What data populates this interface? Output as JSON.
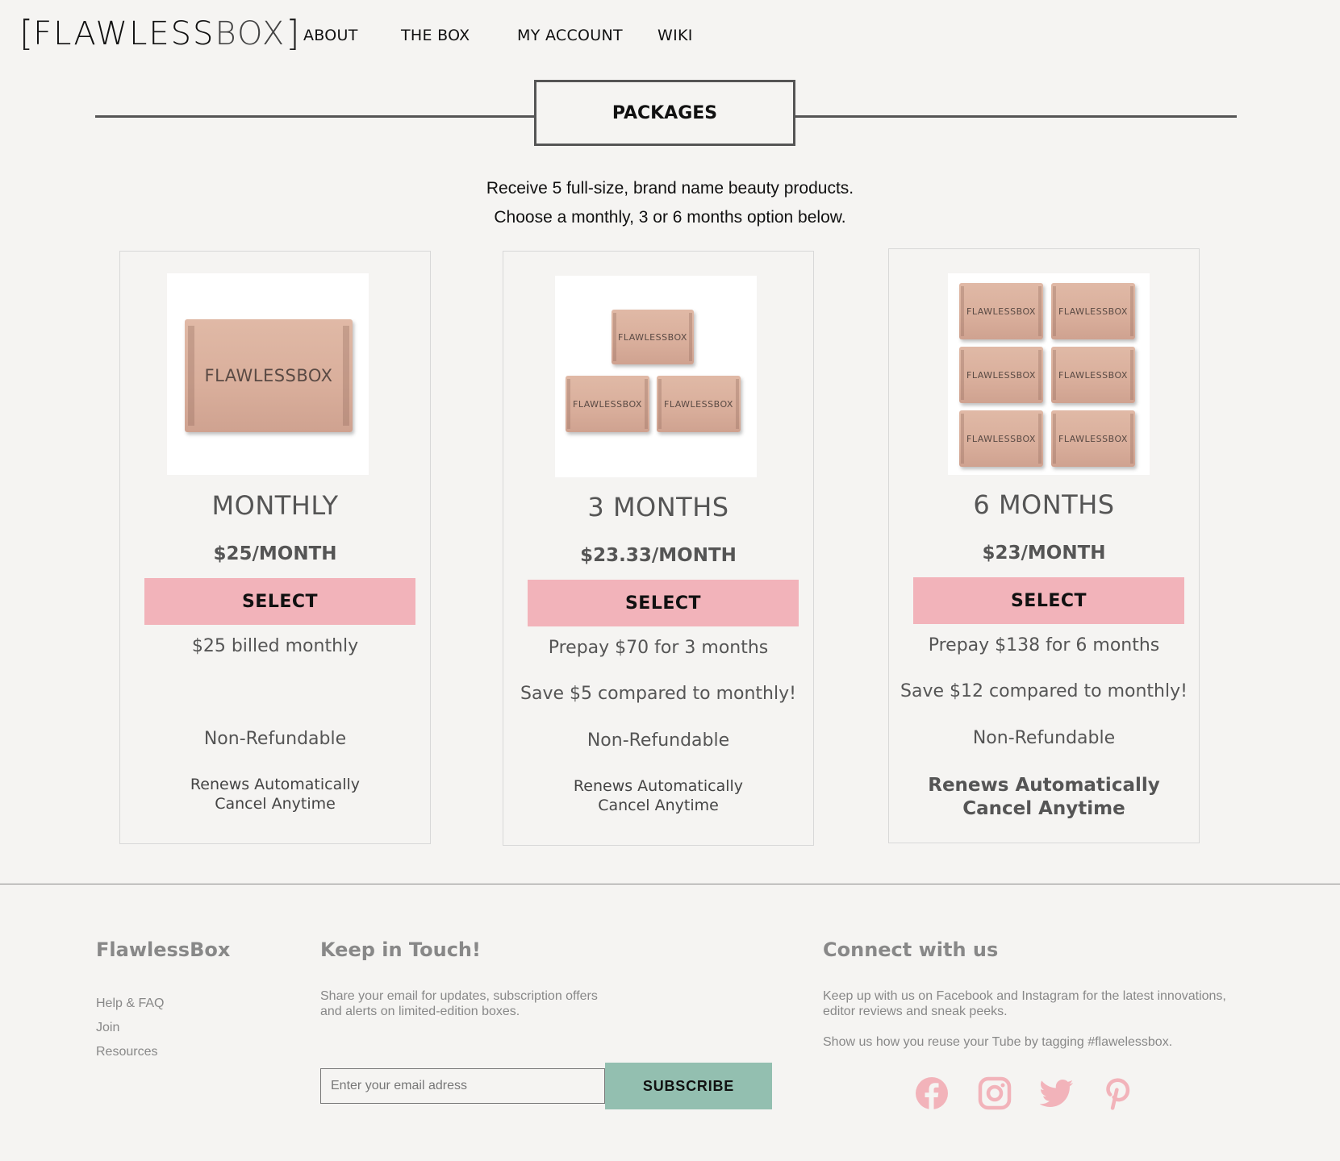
{
  "header": {
    "logo_bracket_left": "[",
    "logo_main": "FLAWLESS",
    "logo_light": "BOX",
    "logo_bracket_right": "]",
    "nav": [
      "ABOUT",
      "THE BOX",
      "MY ACCOUNT",
      "WIKI"
    ]
  },
  "packages": {
    "heading": "PACKAGES",
    "intro_line1": "Receive 5 full-size, brand name beauty products.",
    "intro_line2": "Choose a monthly, 3 or 6 months option below."
  },
  "plans": [
    {
      "name": "MONTHLY",
      "price": "$25/MONTH",
      "select": "SELECT",
      "billing": "$25 billed monthly",
      "savings": "",
      "refund": "Non-Refundable",
      "renew": "Renews Automatically",
      "cancel": "Cancel Anytime",
      "box_count": 1
    },
    {
      "name": "3 MONTHS",
      "price": "$23.33/MONTH",
      "select": "SELECT",
      "billing": "Prepay $70 for 3 months",
      "savings": "Save $5 compared to monthly!",
      "refund": "Non-Refundable",
      "renew": "Renews Automatically",
      "cancel": "Cancel Anytime",
      "box_count": 3
    },
    {
      "name": "6 MONTHS",
      "price": "$23/MONTH",
      "select": "SELECT",
      "billing": "Prepay $138 for 6 months",
      "savings": "Save $12 compared to monthly!",
      "refund": "Non-Refundable",
      "renew": "Renews Automatically",
      "cancel": "Cancel Anytime",
      "box_count": 6
    }
  ],
  "box_label": "FLAWLESSBOX",
  "footer": {
    "brand_title": "FlawlessBox",
    "links": [
      "Help & FAQ",
      "Join",
      "Resources"
    ],
    "keep_title": "Keep in Touch!",
    "keep_line1": "Share your email for updates, subscription offers",
    "keep_line2": "and alerts on limited-edition boxes.",
    "email_placeholder": "Enter your email adress",
    "subscribe": "SUBSCRIBE",
    "connect_title": "Connect with us",
    "connect_line1": "Keep up with us on Facebook and Instagram for the latest innovations,",
    "connect_line2": "editor reviews and sneak peeks.",
    "connect_line3": "Show us how you reuse your Tube by tagging #flawelessbox.",
    "social_icons": [
      "facebook-icon",
      "instagram-icon",
      "twitter-icon",
      "pinterest-icon"
    ],
    "social_color": "#f2b3ba"
  },
  "colors": {
    "background": "#f5f4f2",
    "select_button": "#f2b3ba",
    "subscribe_button": "#93bfb0"
  }
}
